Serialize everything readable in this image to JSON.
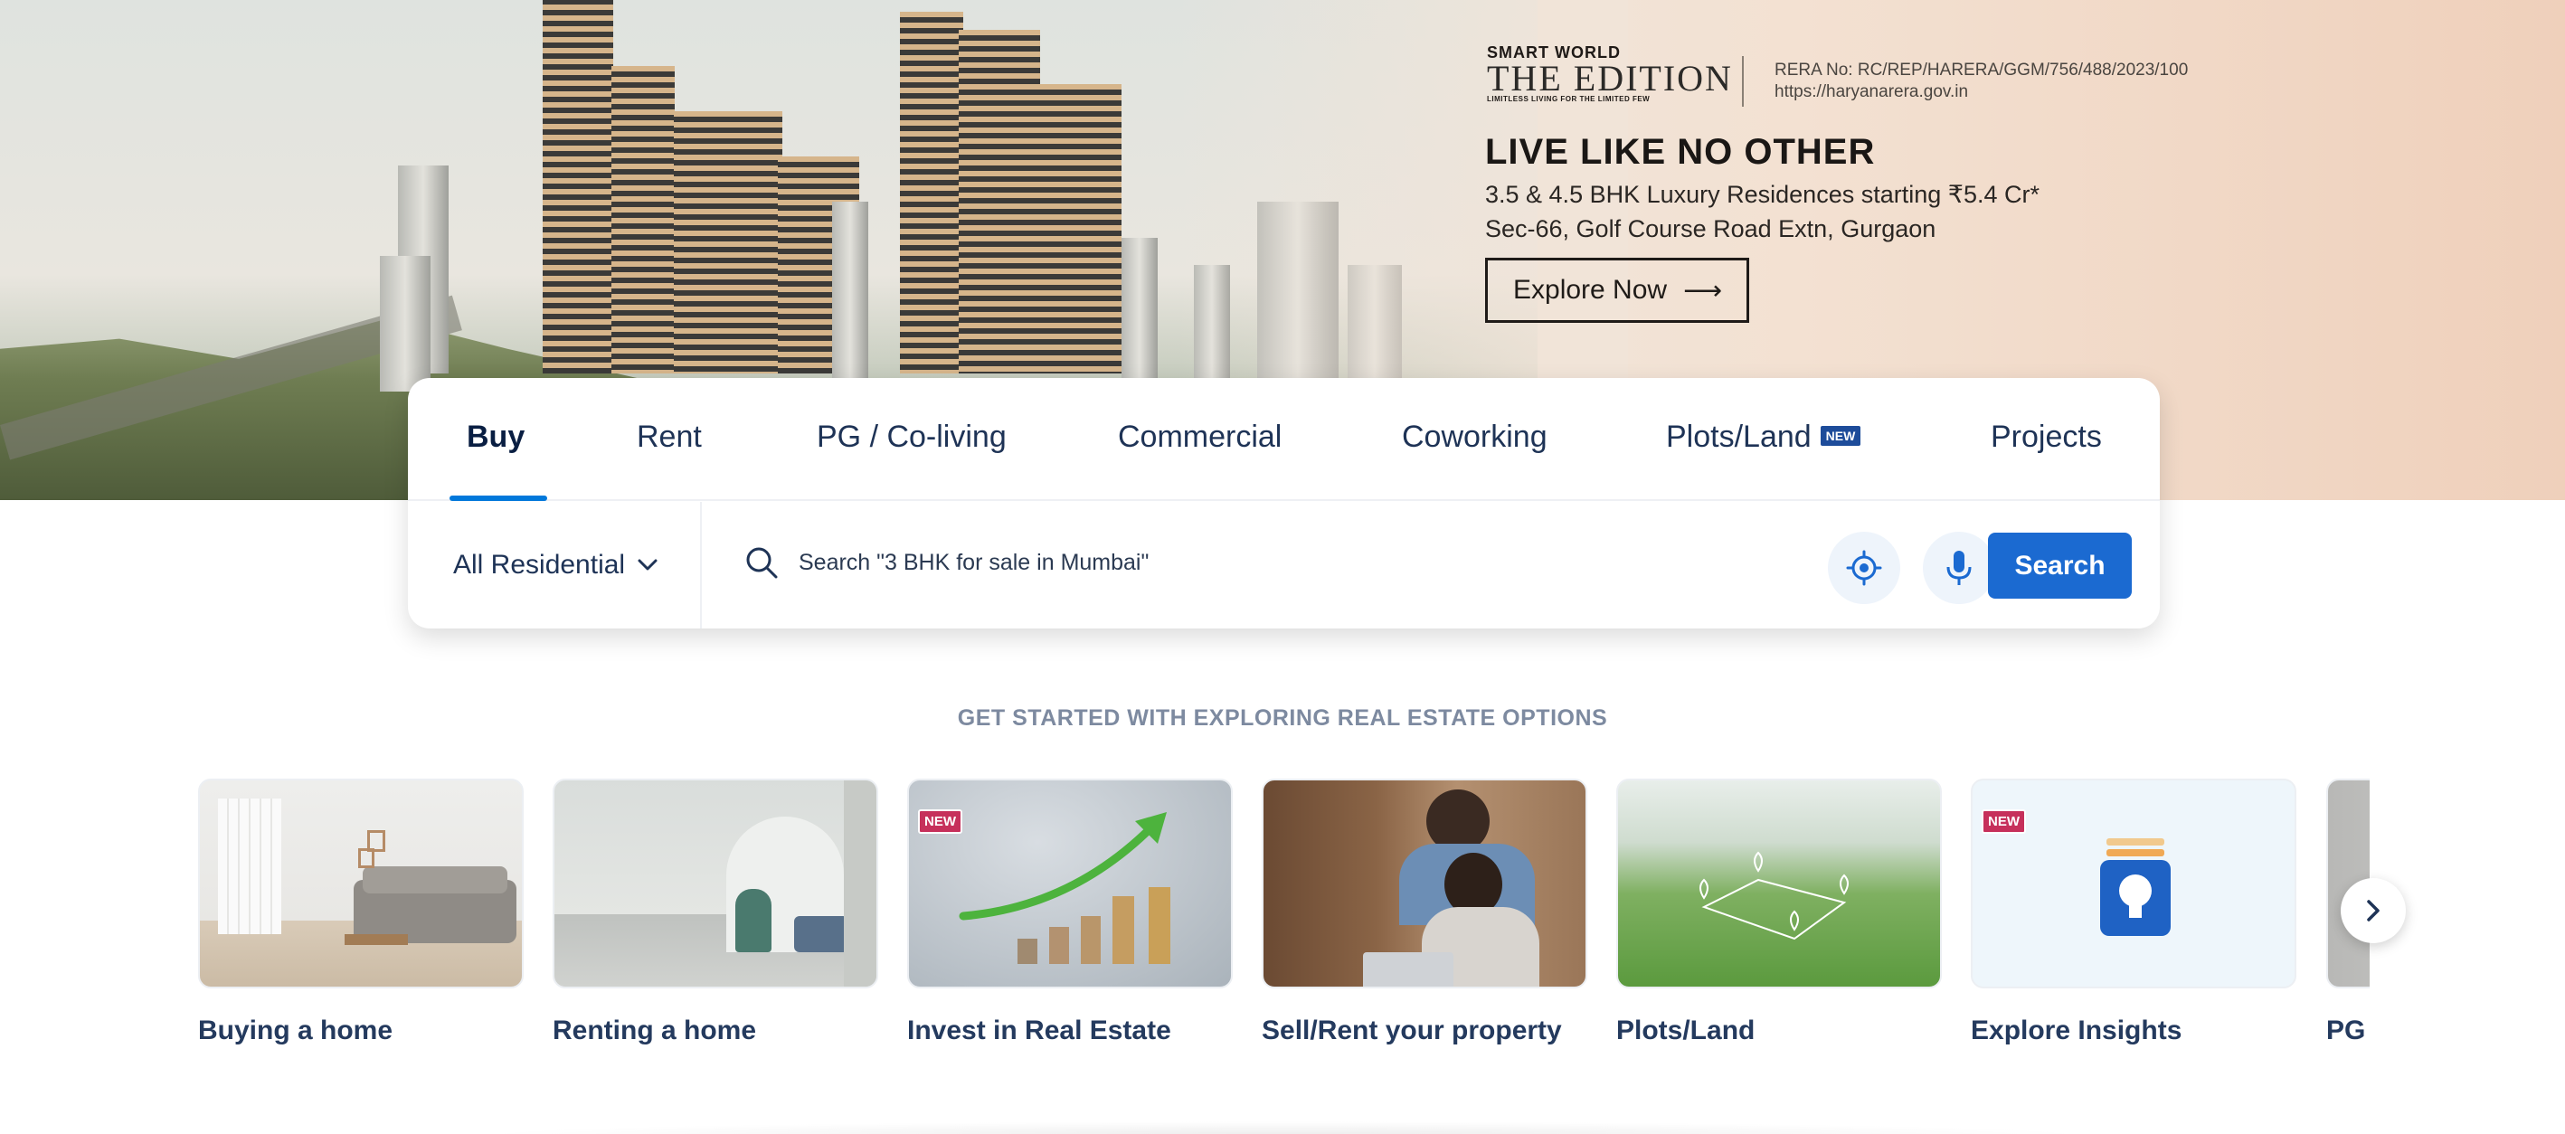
{
  "banner": {
    "brand_top": "SMART WORLD",
    "brand_name": "THE EDITION",
    "brand_tagline": "LIMITLESS LIVING FOR THE LIMITED FEW",
    "rera_no": "RERA No: RC/REP/HARERA/GGM/756/488/2023/100",
    "rera_url": "https://haryanarera.gov.in",
    "headline": "LIVE LIKE NO OTHER",
    "subline1": "3.5 & 4.5 BHK Luxury Residences starting ₹5.4 Cr*",
    "subline2": "Sec-66, Golf Course Road Extn, Gurgaon",
    "cta_label": "Explore Now",
    "cta_arrow": "⟶"
  },
  "search": {
    "tabs": [
      "Buy",
      "Rent",
      "PG / Co-living",
      "Commercial",
      "Coworking",
      "Plots/Land",
      "Projects"
    ],
    "active_tab": "Buy",
    "plots_badge": "NEW",
    "property_type": "All Residential",
    "placeholder": "Search \"3 BHK for sale in Mumbai\"",
    "search_button": "Search",
    "icons": {
      "location": "locate-me-icon",
      "mic": "microphone-icon",
      "search": "magnifier-icon"
    }
  },
  "explore": {
    "title": "GET STARTED WITH EXPLORING REAL ESTATE OPTIONS",
    "new_badge": "NEW",
    "cards": [
      {
        "label": "Buying a home"
      },
      {
        "label": "Renting a home"
      },
      {
        "label": "Invest in Real Estate",
        "badge": "NEW"
      },
      {
        "label": "Sell/Rent your property"
      },
      {
        "label": "Plots/Land"
      },
      {
        "label": "Explore Insights",
        "badge": "NEW"
      },
      {
        "label": "PG and co-living"
      }
    ]
  },
  "colors": {
    "accent": "#1b6ad1",
    "new_badge_red": "#c6305b",
    "new_badge_blue": "#1d4c9a",
    "heading": "#091e42"
  }
}
